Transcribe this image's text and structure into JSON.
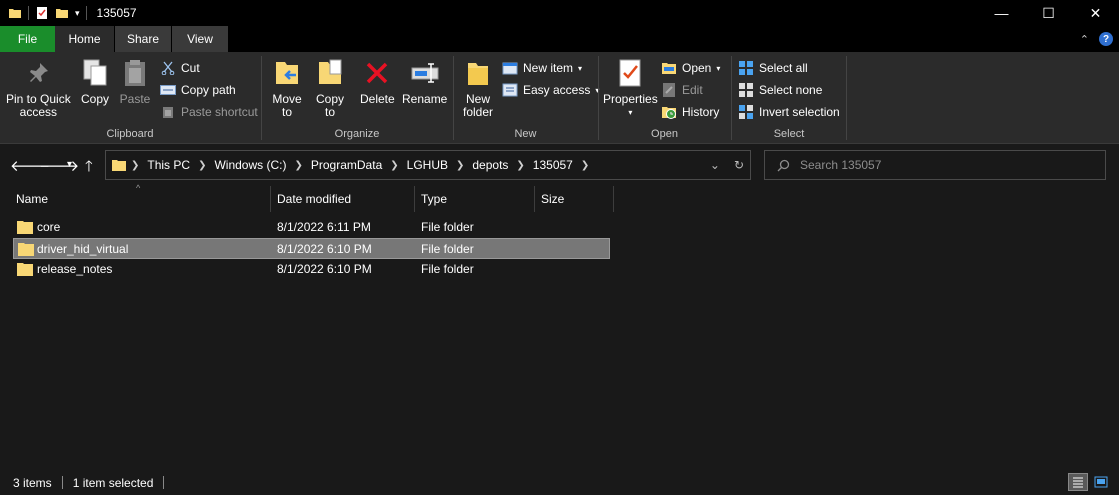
{
  "window": {
    "title": "135057",
    "controls": {
      "minimize": "—",
      "maximize": "☐",
      "close": "✕"
    }
  },
  "tabs": [
    {
      "label": "File"
    },
    {
      "label": "Home"
    },
    {
      "label": "Share"
    },
    {
      "label": "View"
    }
  ],
  "ribbon": {
    "clipboard": {
      "label": "Clipboard",
      "pin_line1": "Pin to Quick",
      "pin_line2": "access",
      "copy": "Copy",
      "paste": "Paste",
      "cut": "Cut",
      "copy_path": "Copy path",
      "paste_shortcut": "Paste shortcut"
    },
    "organize": {
      "label": "Organize",
      "move_line1": "Move",
      "move_line2": "to",
      "copy_line1": "Copy",
      "copy_line2": "to",
      "delete": "Delete",
      "rename": "Rename"
    },
    "new": {
      "label": "New",
      "folder_line1": "New",
      "folder_line2": "folder",
      "new_item": "New item",
      "easy_access": "Easy access"
    },
    "open": {
      "label": "Open",
      "properties": "Properties",
      "open": "Open",
      "edit": "Edit",
      "history": "History"
    },
    "select": {
      "label": "Select",
      "select_all": "Select all",
      "select_none": "Select none",
      "invert": "Invert selection"
    }
  },
  "address": {
    "crumbs": [
      "This PC",
      "Windows (C:)",
      "ProgramData",
      "LGHUB",
      "depots",
      "135057"
    ]
  },
  "search": {
    "placeholder": "Search 135057"
  },
  "columns": {
    "name": "Name",
    "date": "Date modified",
    "type": "Type",
    "size": "Size"
  },
  "files": [
    {
      "name": "core",
      "date": "8/1/2022 6:11 PM",
      "type": "File folder",
      "selected": false
    },
    {
      "name": "driver_hid_virtual",
      "date": "8/1/2022 6:10 PM",
      "type": "File folder",
      "selected": true
    },
    {
      "name": "release_notes",
      "date": "8/1/2022 6:10 PM",
      "type": "File folder",
      "selected": false
    }
  ],
  "status": {
    "items": "3 items",
    "selected": "1 item selected"
  },
  "colors": {
    "file_tab": "#1a8d2b",
    "folder": "#f8d775",
    "selection": "#777777"
  }
}
